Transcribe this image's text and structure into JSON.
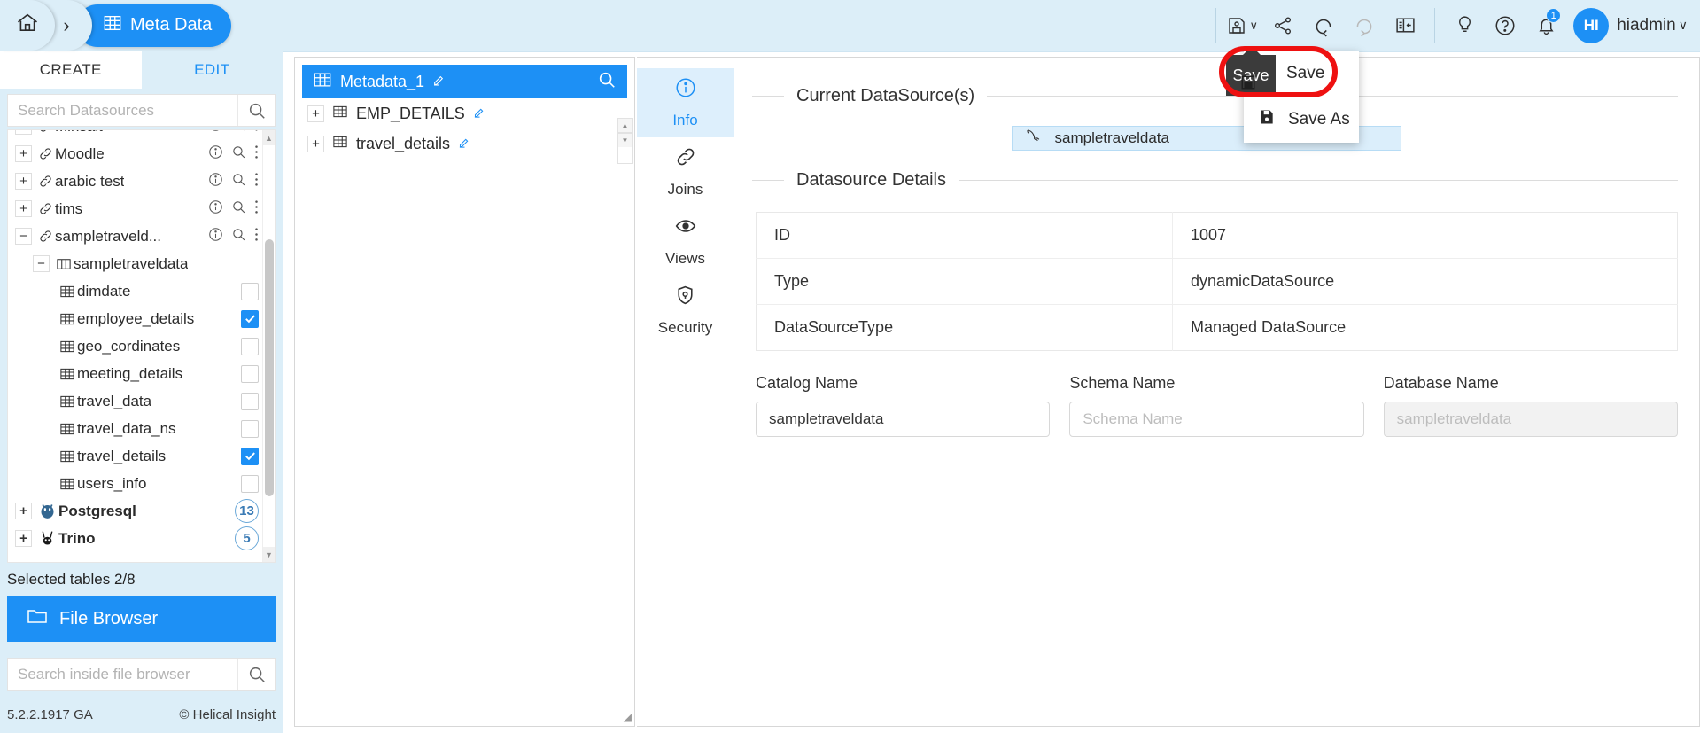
{
  "topbar": {
    "home_icon": "home-icon",
    "chevron": "›",
    "breadcrumb_active": "Meta Data",
    "icons": [
      {
        "name": "save-icon",
        "label": "Save"
      },
      {
        "name": "share-icon",
        "label": "Share"
      },
      {
        "name": "undo-icon",
        "label": "Undo"
      },
      {
        "name": "redo-icon",
        "label": "Redo"
      },
      {
        "name": "panel-toggle-icon",
        "label": "Toggle Panel"
      },
      {
        "name": "bulb-icon",
        "label": "Tips"
      },
      {
        "name": "help-icon",
        "label": "Help"
      },
      {
        "name": "bell-icon",
        "label": "Notifications"
      }
    ],
    "notification_count": "1",
    "avatar_initials": "HI",
    "username": "hiadmin",
    "user_caret": "∨"
  },
  "sidebar": {
    "tabs": [
      {
        "label": "CREATE",
        "active": true
      },
      {
        "label": "EDIT",
        "active": false
      }
    ],
    "search_placeholder": "Search Datasources",
    "search_value": "",
    "tree": [
      {
        "label": "Minsait",
        "level": 1,
        "expander": "+",
        "icon": "link-icon",
        "acts": true
      },
      {
        "label": "Moodle",
        "level": 1,
        "expander": "+",
        "icon": "link-icon",
        "acts": true
      },
      {
        "label": "arabic test",
        "level": 1,
        "expander": "+",
        "icon": "link-icon",
        "acts": true
      },
      {
        "label": "tims",
        "level": 1,
        "expander": "+",
        "icon": "link-icon",
        "acts": true
      },
      {
        "label": "sampletraveld...",
        "level": 1,
        "expander": "−",
        "icon": "link-icon",
        "acts": true
      },
      {
        "label": "sampletraveldata",
        "level": 2,
        "expander": "−",
        "icon": "schema-icon"
      },
      {
        "label": "dimdate",
        "level": 3,
        "icon": "table-icon",
        "checkbox": false
      },
      {
        "label": "employee_details",
        "level": 3,
        "icon": "table-icon",
        "checkbox": true
      },
      {
        "label": "geo_cordinates",
        "level": 3,
        "icon": "table-icon",
        "checkbox": false
      },
      {
        "label": "meeting_details",
        "level": 3,
        "icon": "table-icon",
        "checkbox": false
      },
      {
        "label": "travel_data",
        "level": 3,
        "icon": "table-icon",
        "checkbox": false
      },
      {
        "label": "travel_data_ns",
        "level": 3,
        "icon": "table-icon",
        "checkbox": false
      },
      {
        "label": "travel_details",
        "level": 3,
        "icon": "table-icon",
        "checkbox": true
      },
      {
        "label": "users_info",
        "level": 3,
        "icon": "table-icon",
        "checkbox": false
      },
      {
        "label": "Postgresql",
        "level": 1,
        "expander": "+",
        "icon": "postgres-icon",
        "count": "13",
        "bold": true
      },
      {
        "label": "Trino",
        "level": 1,
        "expander": "+",
        "icon": "trino-icon",
        "count": "5",
        "bold": true
      }
    ],
    "selected_tables": "Selected tables 2/8",
    "file_browser": "File Browser",
    "file_browser_search_placeholder": "Search inside file browser",
    "file_browser_search_value": "",
    "version": "5.2.2.1917 GA",
    "copyright": "© Helical Insight"
  },
  "meta_panel": {
    "title": "Metadata_1",
    "edit_icon": "pencil-icon",
    "search_icon": "search-icon",
    "tables": [
      {
        "label": "EMP_DETAILS",
        "expander": "+"
      },
      {
        "label": "travel_details",
        "expander": "+"
      }
    ]
  },
  "vtabs": [
    {
      "label": "Info",
      "icon": "info-icon",
      "active": true
    },
    {
      "label": "Joins",
      "icon": "link-icon",
      "active": false
    },
    {
      "label": "Views",
      "icon": "eye-icon",
      "active": false
    },
    {
      "label": "Security",
      "icon": "shield-lock-icon",
      "active": false
    }
  ],
  "content": {
    "current_datasource_legend": "Current DataSource(s)",
    "datasource_chip": "sampletraveldata",
    "datasource_chip_icon": "mysql-dolphin-icon",
    "datasource_details_legend": "Datasource Details",
    "details_rows": [
      {
        "key": "ID",
        "value": "1007"
      },
      {
        "key": "Type",
        "value": "dynamicDataSource"
      },
      {
        "key": "DataSourceType",
        "value": "Managed DataSource"
      }
    ],
    "fields": [
      {
        "label": "Catalog Name",
        "value": "sampletraveldata",
        "placeholder": "Catalog Name",
        "disabled": false
      },
      {
        "label": "Schema Name",
        "value": "",
        "placeholder": "Schema Name",
        "disabled": false
      },
      {
        "label": "Database Name",
        "value": "",
        "placeholder": "sampletraveldata",
        "disabled": true
      }
    ]
  },
  "save_menu": {
    "tooltip": "Save",
    "items": [
      {
        "label": "Save",
        "icon": "save-disk-icon",
        "show_icon": false
      },
      {
        "label": "Save As",
        "icon": "save-as-icon",
        "show_icon": true
      }
    ]
  },
  "colors": {
    "accent": "#1d90f5",
    "topbar_bg": "#dceef8",
    "highlight_red": "#ee1111",
    "tooltip_bg": "#3b3b3b"
  }
}
